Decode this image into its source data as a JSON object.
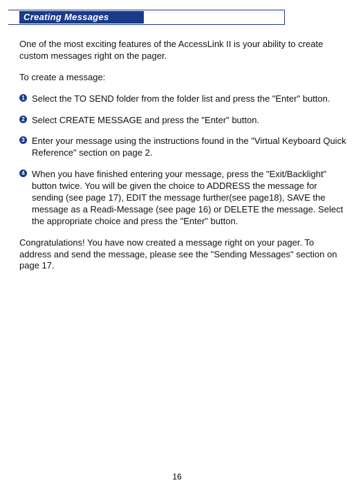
{
  "title": "Creating Messages",
  "intro": "One of the most exciting features of the AccessLink II is your ability to create custom messages right on the pager.",
  "leadIn": "To create a message:",
  "steps": [
    "Select the TO SEND folder from the folder list and press the \"Enter\" button.",
    "Select CREATE MESSAGE and press the \"Enter\" button.",
    "Enter your message using the instructions found in the \"Virtual Keyboard Quick Reference\" section on page 2.",
    "When you have finished entering your message, press the \"Exit/Backlight\" button twice.  You will be given the choice to ADDRESS the message for sending (see page 17), EDIT the message further(see page18), SAVE the message as a Readi-Message (see page 16) or DELETE the message.  Select the appropriate choice and press the \"Enter\" button."
  ],
  "outro": "Congratulations!  You have now created a message right on your pager.  To address and send the message, please see the \"Sending Messages\" section on page 17.",
  "pageNumber": "16"
}
